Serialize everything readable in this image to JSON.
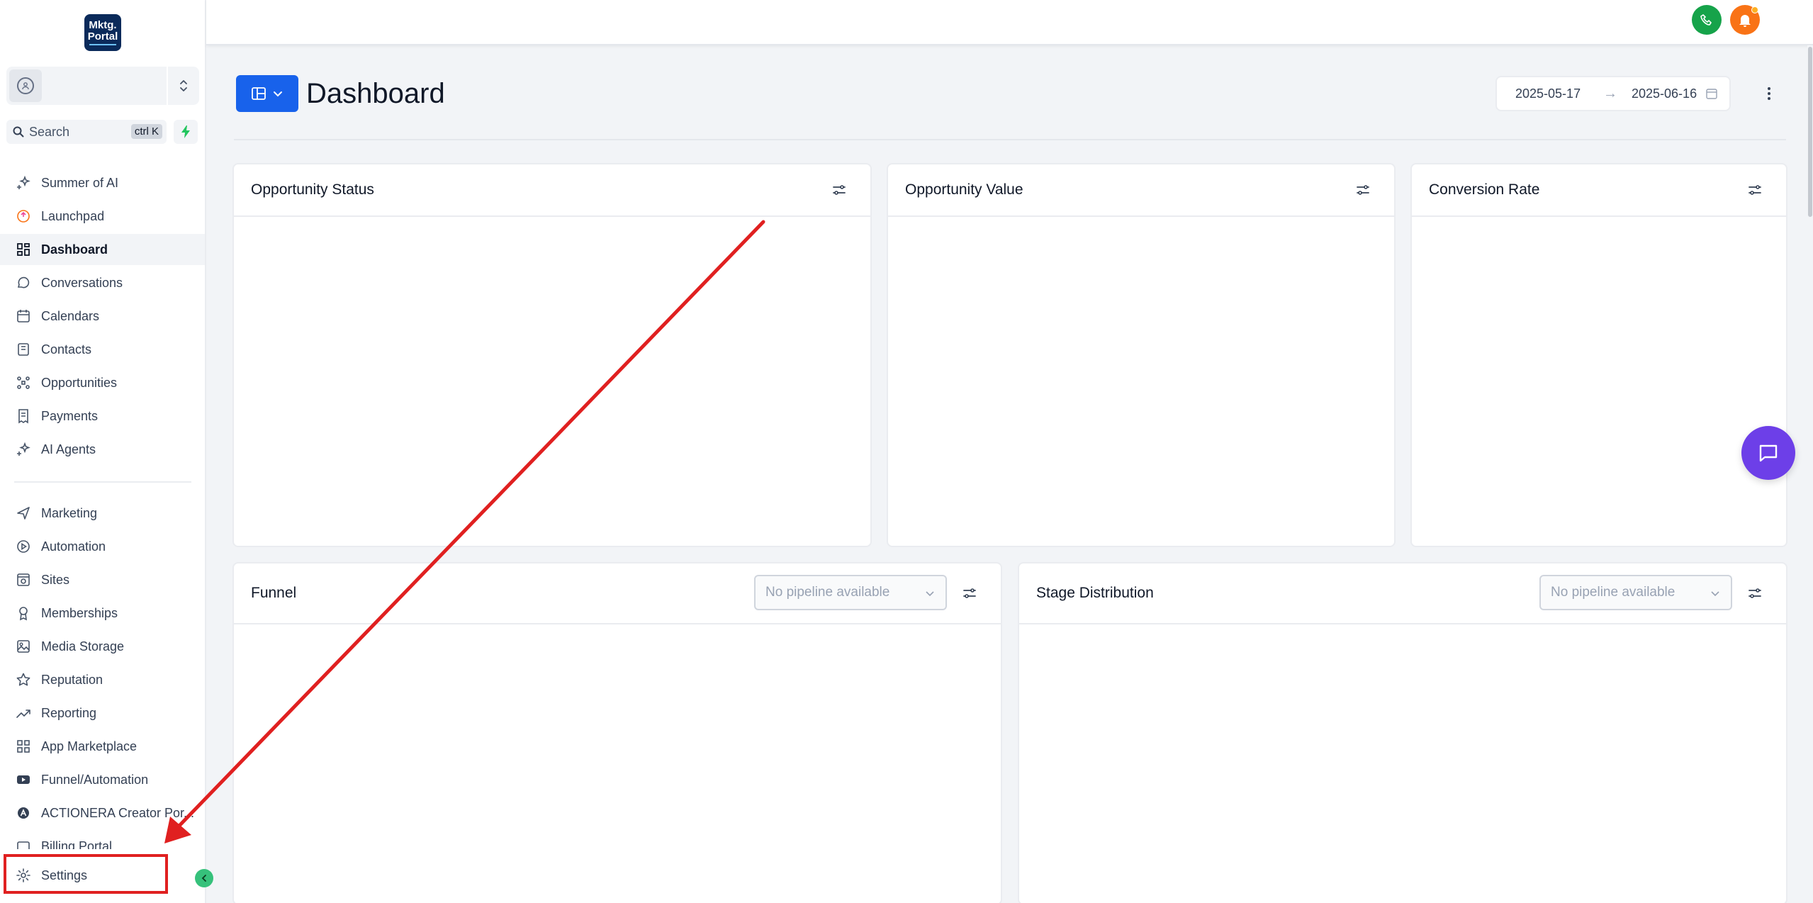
{
  "logo": {
    "line1": "Mktg.",
    "line2": "Portal"
  },
  "search": {
    "placeholder": "Search",
    "shortcut": "ctrl K"
  },
  "sidebar": {
    "items": [
      {
        "label": "Summer of AI",
        "icon": "sparkle-icon"
      },
      {
        "label": "Launchpad",
        "icon": "rocket-icon"
      },
      {
        "label": "Dashboard",
        "icon": "grid-icon",
        "active": true
      },
      {
        "label": "Conversations",
        "icon": "chat-icon"
      },
      {
        "label": "Calendars",
        "icon": "calendar-icon"
      },
      {
        "label": "Contacts",
        "icon": "contacts-icon"
      },
      {
        "label": "Opportunities",
        "icon": "opportunities-icon"
      },
      {
        "label": "Payments",
        "icon": "receipt-icon"
      },
      {
        "label": "AI Agents",
        "icon": "sparkle-icon"
      }
    ],
    "items2": [
      {
        "label": "Marketing",
        "icon": "send-icon"
      },
      {
        "label": "Automation",
        "icon": "play-icon"
      },
      {
        "label": "Sites",
        "icon": "browser-icon"
      },
      {
        "label": "Memberships",
        "icon": "award-icon"
      },
      {
        "label": "Media Storage",
        "icon": "image-icon"
      },
      {
        "label": "Reputation",
        "icon": "star-icon"
      },
      {
        "label": "Reporting",
        "icon": "trend-icon"
      },
      {
        "label": "App Marketplace",
        "icon": "apps-icon"
      },
      {
        "label": "Funnel/Automation",
        "icon": "video-icon"
      },
      {
        "label": "ACTIONERA Creator Por...",
        "icon": "actionera-icon"
      },
      {
        "label": "Billing Portal",
        "icon": "billing-icon"
      }
    ],
    "settings": "Settings"
  },
  "header": {
    "title": "Dashboard",
    "date_start": "2025-05-17",
    "date_end": "2025-06-16"
  },
  "cards": {
    "opportunity_status": "Opportunity Status",
    "opportunity_value": "Opportunity Value",
    "conversion_rate": "Conversion Rate",
    "funnel": "Funnel",
    "stage_distribution": "Stage Distribution",
    "pipeline_placeholder": "No pipeline available"
  },
  "colors": {
    "primary": "#1862eb",
    "phone": "#16a34a",
    "bell": "#f97316",
    "chat": "#6d3fe8",
    "annotation": "#e02020"
  }
}
